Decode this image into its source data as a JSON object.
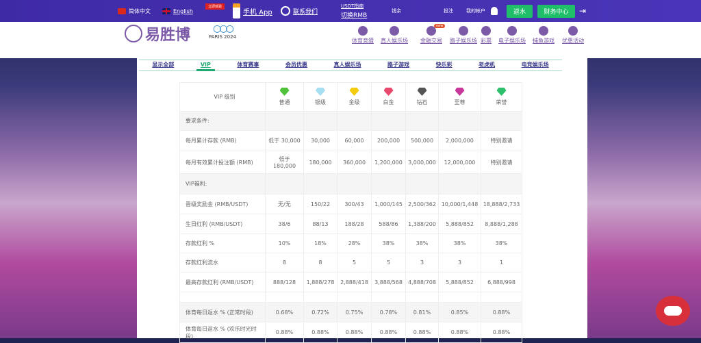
{
  "topbar": {
    "lang_cn": "简体中文",
    "lang_en": "English",
    "badge": "立即体验",
    "app": "手机 App",
    "contact": "联系我们",
    "usdt_guide": "USDT指南",
    "switch_rmb": "切换RMB",
    "balance": "钱余",
    "bets": "投注",
    "my_account": "我的帐户",
    "rebate_btn": "返水",
    "finance_btn": "财务中心"
  },
  "header": {
    "logo": "易胜博",
    "olympics": "PARIS 2024",
    "nav": [
      {
        "label": "体育竞猜"
      },
      {
        "label": "真人娱乐场"
      },
      {
        "label": "金融交易",
        "badge": "new"
      },
      {
        "label": "路子娱乐场"
      },
      {
        "label": "彩票"
      },
      {
        "label": "电子娱乐场"
      },
      {
        "label": "捕鱼游戏"
      },
      {
        "label": "优惠活动"
      }
    ]
  },
  "tabs": [
    "显示全部",
    "VIP",
    "体育赛事",
    "会员优惠",
    "真人娱乐场",
    "路子游戏",
    "快乐彩",
    "老虎机",
    "电竞娱乐场"
  ],
  "colors": {
    "gems": [
      "#4fc23a",
      "#a6def2",
      "#f5cd10",
      "#e84a6e",
      "#555555",
      "#c8379a",
      "#2dbf6a"
    ]
  },
  "table": {
    "header": "VIP 级别",
    "levels": [
      "普通",
      "银级",
      "金级",
      "白金",
      "钻石",
      "至尊",
      "荣誉"
    ],
    "rows": [
      {
        "label": "要求条件:",
        "values": [
          "",
          "",
          "",
          "",
          "",
          "",
          ""
        ],
        "gray": true
      },
      {
        "label": "每月累计存款 (RMB)",
        "values": [
          "低于 30,000",
          "30,000",
          "60,000",
          "200,000",
          "500,000",
          "2,000,000",
          "特别邀请"
        ]
      },
      {
        "label": "每月有效累计投注额 (RMB)",
        "values": [
          "低于 180,000",
          "180,000",
          "360,000",
          "1,200,000",
          "3,000,000",
          "12,000,000",
          "特别邀请"
        ]
      },
      {
        "label": "VIP福利:",
        "values": [
          "",
          "",
          "",
          "",
          "",
          "",
          ""
        ],
        "gray": true
      },
      {
        "label": "晋级奖励金 (RMB/USDT)",
        "values": [
          "无/无",
          "150/22",
          "300/43",
          "1,000/145",
          "2,500/362",
          "10,000/1,448",
          "18,888/2,733"
        ]
      },
      {
        "label": "生日红利 (RMB/USDT)",
        "values": [
          "38/6",
          "88/13",
          "188/28",
          "588/86",
          "1,388/200",
          "5,888/852",
          "8,888/1,288"
        ]
      },
      {
        "label": "存款红利 %",
        "values": [
          "10%",
          "18%",
          "28%",
          "38%",
          "38%",
          "38%",
          "38%"
        ]
      },
      {
        "label": "存款红利流水",
        "values": [
          "8",
          "8",
          "5",
          "5",
          "3",
          "3",
          "1"
        ]
      },
      {
        "label": "最高存款红利 (RMB/USDT)",
        "values": [
          "888/128",
          "1,888/278",
          "2,888/418",
          "3,888/568",
          "4,888/708",
          "5,888/852",
          "6,888/998"
        ]
      },
      {
        "label": "",
        "values": [
          "",
          "",
          "",
          "",
          "",
          "",
          ""
        ]
      },
      {
        "label": "体育每日返水 % (正常时段)",
        "values": [
          "0.68%",
          "0.72%",
          "0.75%",
          "0.78%",
          "0.81%",
          "0.85%",
          "0.88%"
        ],
        "gray": true
      },
      {
        "label": "体育每日返水 % (欢乐时光时段)",
        "values": [
          "0.88%",
          "0.88%",
          "0.88%",
          "0.88%",
          "0.88%",
          "0.88%",
          "0.88%"
        ]
      }
    ]
  }
}
